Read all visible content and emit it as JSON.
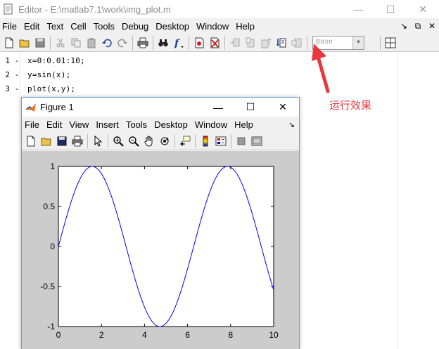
{
  "editor": {
    "title": "Editor - E:\\matlab7.1\\work\\img_plot.m",
    "window_controls": {
      "minimize": "—",
      "maximize": "☐",
      "close": "✕"
    },
    "menu": [
      "File",
      "Edit",
      "Text",
      "Cell",
      "Tools",
      "Debug",
      "Desktop",
      "Window",
      "Help"
    ],
    "menu_right": [
      "↘",
      "⧉",
      "✕"
    ],
    "stack_label": "Base",
    "code_lines": [
      {
        "num": "1",
        "mark": "-",
        "text": "x=0:0.01:10;"
      },
      {
        "num": "2",
        "mark": "-",
        "text": "y=sin(x);"
      },
      {
        "num": "3",
        "mark": "-",
        "text": "plot(x,y);"
      }
    ]
  },
  "annotation": {
    "text": "运行效果",
    "color": "#e8383d"
  },
  "figure": {
    "title": "Figure 1",
    "window_controls": {
      "minimize": "—",
      "maximize": "☐",
      "close": "✕"
    },
    "menu": [
      "File",
      "Edit",
      "View",
      "Insert",
      "Tools",
      "Desktop",
      "Window",
      "Help"
    ],
    "menu_corner": "↘"
  },
  "chart_data": {
    "type": "line",
    "title": "",
    "xlabel": "",
    "ylabel": "",
    "xlim": [
      0,
      10
    ],
    "ylim": [
      -1,
      1
    ],
    "xticks": [
      0,
      2,
      4,
      6,
      8,
      10
    ],
    "yticks": [
      -1,
      -0.5,
      0,
      0.5,
      1
    ],
    "xtick_labels": [
      "0",
      "2",
      "4",
      "6",
      "8",
      "10"
    ],
    "ytick_labels": [
      "-1",
      "-0.5",
      "0",
      "0.5",
      "1"
    ],
    "series": [
      {
        "color": "#0000ff",
        "function": "sin",
        "x": [
          0,
          0.5,
          1,
          1.5,
          1.57,
          2,
          2.5,
          3,
          3.14,
          3.5,
          4,
          4.5,
          4.71,
          5,
          5.5,
          6,
          6.28,
          6.5,
          7,
          7.5,
          7.85,
          8,
          8.5,
          9,
          9.42,
          9.5,
          10
        ],
        "y": [
          0,
          0.479,
          0.841,
          0.997,
          1.0,
          0.909,
          0.598,
          0.141,
          0.0,
          -0.351,
          -0.757,
          -0.978,
          -1.0,
          -0.959,
          -0.706,
          -0.279,
          0.0,
          0.215,
          0.657,
          0.938,
          1.0,
          0.989,
          0.798,
          0.412,
          0.0,
          -0.075,
          -0.544
        ]
      }
    ],
    "grid": false,
    "axes_background": "#ffffff",
    "figure_background": "#cccccc"
  }
}
